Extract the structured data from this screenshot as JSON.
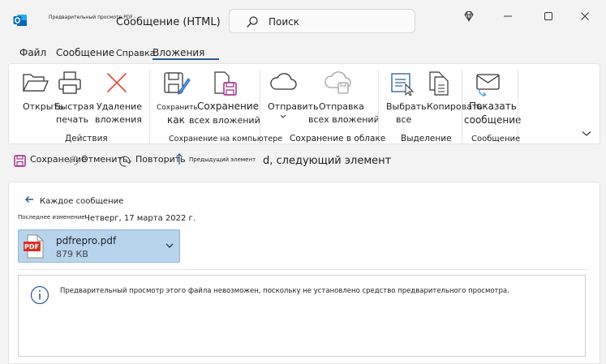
{
  "window": {
    "tiny_caption": "Предварительный просмотр PDF -",
    "title": "Сообщение (HTML)",
    "search_placeholder": "Поиск"
  },
  "tabs": [
    "Файл",
    "Сообщение",
    "Справка",
    "Вложения"
  ],
  "ribbon": {
    "buttons": {
      "open": "Открыть",
      "quick_print_1": "Быстрая",
      "quick_print_2": "печать",
      "remove_1": "Удаление",
      "remove_2": "вложения",
      "save_as_1": "Сохранить",
      "save_as_2": "как",
      "save_all_1": "Сохранение",
      "save_all_2": "всех вложений",
      "send_1": "Отправить",
      "send_all_1": "Отправка",
      "send_all_2": "всех вложений",
      "select_all_1": "Выбрать",
      "select_all_2": "все",
      "copy": "Копировать",
      "show_msg_1": "Показать",
      "show_msg_2": "сообщение"
    },
    "groups": {
      "actions": "Действия",
      "save_computer": "Сохранение на компьютере",
      "save_cloud": "Сохранение в облаке",
      "selection": "Выделение",
      "message": "Сообщение"
    }
  },
  "quick_access": {
    "save": "Сохранение",
    "undo": "Отменить",
    "redo": "Повторить",
    "prev_item": "Предыдущий элемент",
    "next_item": "d, следующий элемент"
  },
  "message": {
    "back_link": "Каждое сообщение",
    "last_modified_label": "Последнее изменение:",
    "last_modified_value": "Четверг, 17 марта 2022 г."
  },
  "attachment": {
    "badge": "PDF",
    "name": "pdfrepro.pdf",
    "size": "879 КВ"
  },
  "preview": {
    "message": "Предварительный просмотр этого файла невозможен, поскольку не установлено средство предварительного просмотра."
  },
  "colors": {
    "accent": "#2b5797",
    "outlook_blue": "#0f6cbd",
    "attachment_bg": "#b8d4ed",
    "pdf_red": "#d93025",
    "save_purple": "#9b2a8a",
    "remove_red": "#e04a3c"
  }
}
